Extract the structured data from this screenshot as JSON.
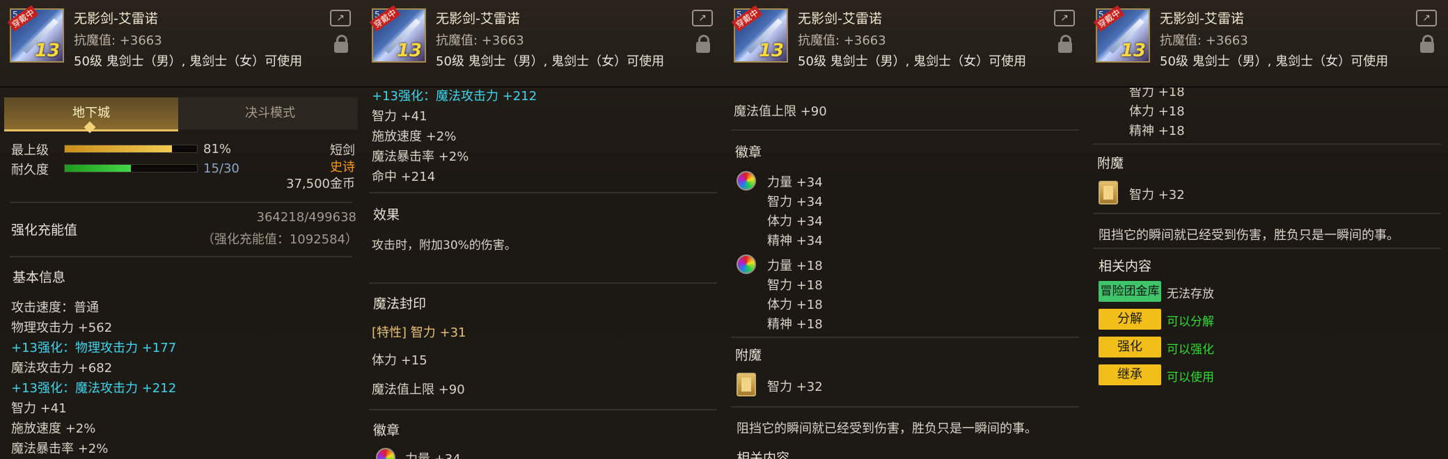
{
  "header": {
    "item_name": "无影剑-艾雷诺",
    "resist": "抗魔值: +3663",
    "usable": "50级 鬼剑士（男）, 鬼剑士（女）可使用",
    "icon_tag": "穿戴中",
    "icon_level": "13",
    "icon_corner": "5",
    "share_icon": "share-icon",
    "lock_icon": "lock-icon"
  },
  "tabs": {
    "dungeon": "地下城",
    "duel": "决斗模式"
  },
  "grade": {
    "label": "最上级",
    "value": "81%",
    "progress": 0.81
  },
  "durability": {
    "label": "耐久度",
    "value": "15/30",
    "progress": 0.5
  },
  "item_type": "短剑",
  "rarity": "史诗",
  "price": "37,500金币",
  "reinforce": {
    "label": "强化充能值",
    "value": "364218/499638",
    "detail": "（强化充能值：1092584）"
  },
  "basic_info": {
    "title": "基本信息",
    "attack_speed": "攻击速度：普通",
    "phys_atk": "物理攻击力 +562",
    "phys_bonus": "+13强化：物理攻击力 +177",
    "mag_atk": "魔法攻击力 +682",
    "mag_bonus": "+13强化：魔法攻击力 +212",
    "int": "智力 +41",
    "cast_speed": "施放速度 +2%",
    "mag_crit": "魔法暴击率 +2%",
    "hit": "命中 +214"
  },
  "effect": {
    "title": "效果",
    "text": "攻击时，附加30%的伤害。"
  },
  "seal": {
    "title": "魔法封印",
    "trait": "[特性] 智力 +31",
    "vit": "体力 +15",
    "mp": "魔法值上限 +90"
  },
  "emblem": {
    "title": "徽章",
    "gem1": [
      "力量 +34",
      "智力 +34",
      "体力 +34",
      "精神 +34"
    ],
    "gem2": [
      "力量 +18",
      "智力 +18",
      "体力 +18",
      "精神 +18"
    ]
  },
  "enchant": {
    "title": "附魔",
    "stat": "智力 +32"
  },
  "flavor": "阻挡它的瞬间就已经受到伤害，胜负只是一瞬间的事。",
  "related": {
    "title": "相关内容",
    "storage_label": "冒险团金库",
    "storage_value": "无法存放",
    "disassemble_label": "分解",
    "disassemble_value": "可以分解",
    "enhance_label": "强化",
    "enhance_value": "可以强化",
    "inherit_label": "继承",
    "inherit_value": "可以使用"
  },
  "colors": {
    "bonus": "#3fd6ee",
    "epic": "#ff9a1e",
    "ok": "#2dde2d",
    "badge": "#f2be19"
  }
}
